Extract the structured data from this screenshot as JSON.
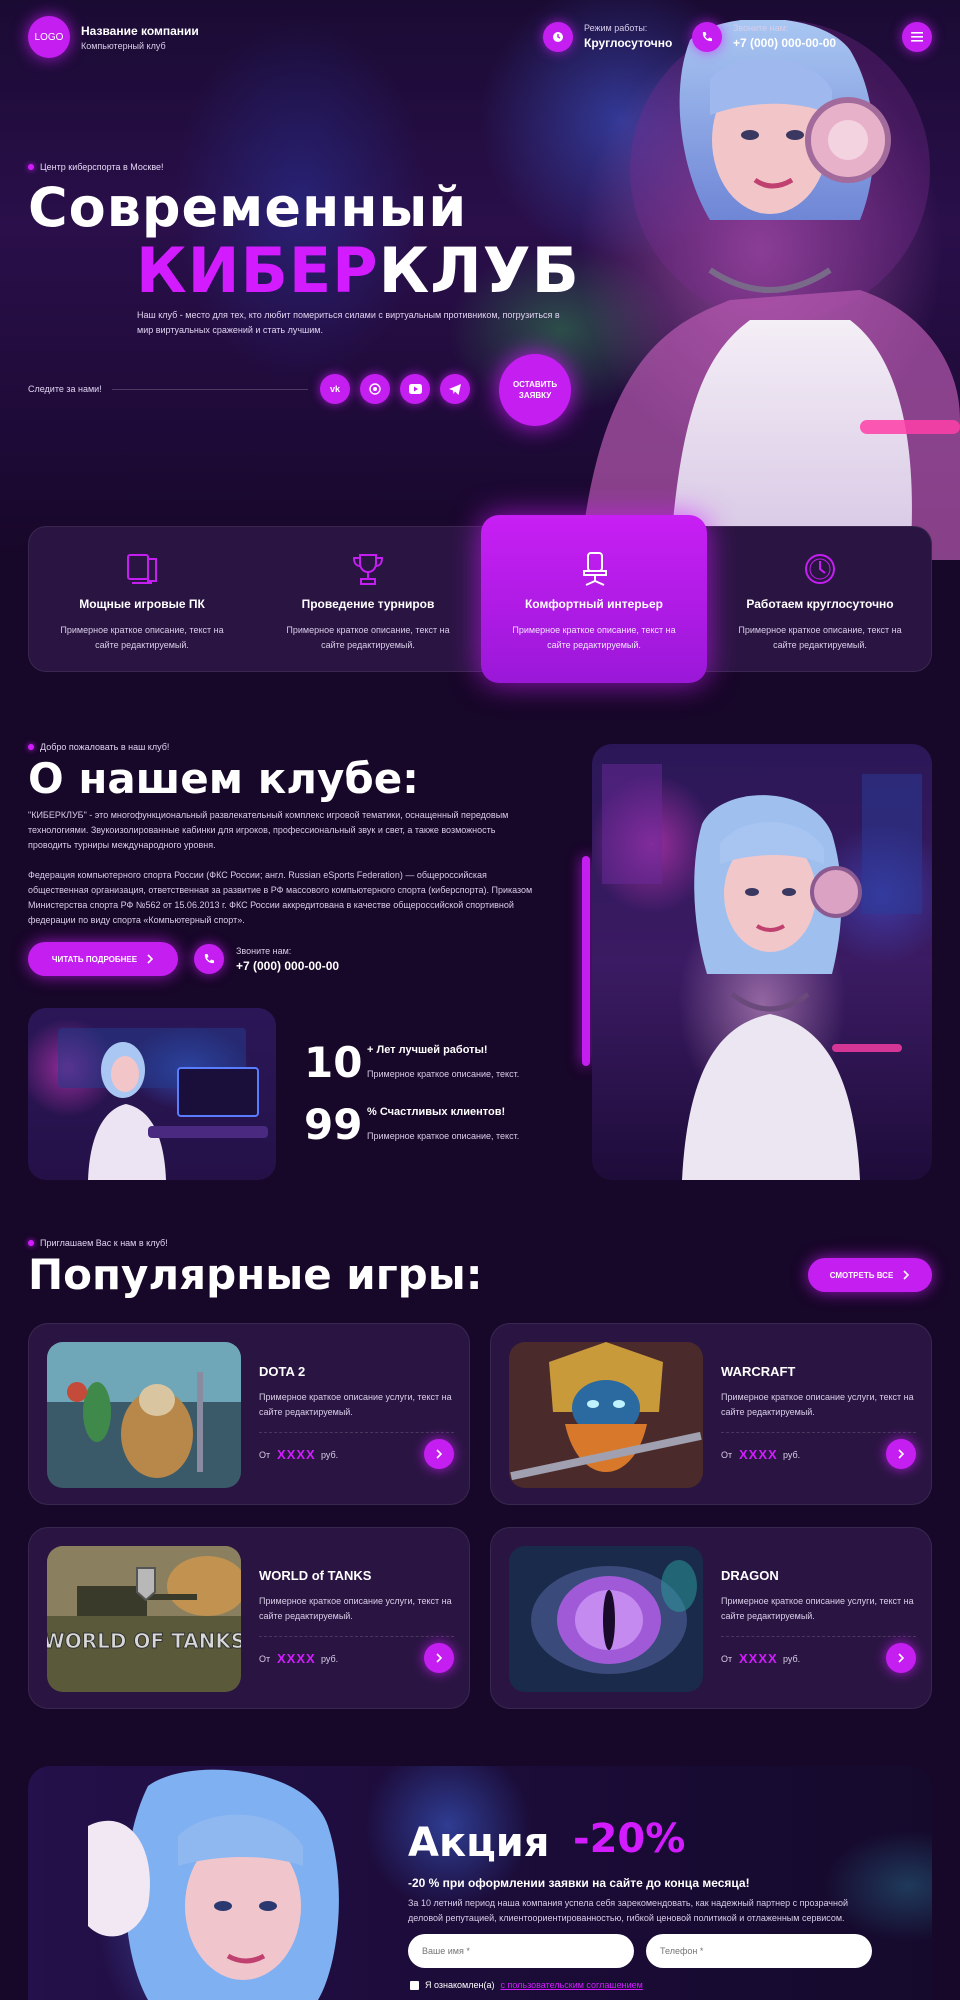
{
  "header": {
    "logo": "LOGO",
    "company_name": "Название компании",
    "company_sub": "Компьютерный клуб",
    "hours_label": "Режим работы:",
    "hours_value": "Круглосуточно",
    "phone_label": "Звоните нам:",
    "phone_value": "+7 (000) 000-00-00"
  },
  "hero": {
    "eyebrow": "Центр киберспорта в Москве!",
    "title_line1": "Современный",
    "title_accent": "КИБЕР",
    "title_rest": "КЛУБ",
    "description": "Наш клуб - место для тех, кто любит помериться силами с виртуальным противником, погрузиться в мир виртуальных сражений и стать лучшим.",
    "follow_label": "Следите за нами!",
    "socials": [
      "vk-icon",
      "whatsapp-icon",
      "youtube-icon",
      "telegram-icon"
    ],
    "cta": "ОСТАВИТЬ ЗАЯВКУ"
  },
  "features": [
    {
      "icon": "pc-icon",
      "title": "Мощные игровые ПК",
      "desc": "Примерное краткое описание, текст на сайте редактируемый."
    },
    {
      "icon": "trophy-icon",
      "title": "Проведение турниров",
      "desc": "Примерное краткое описание, текст на сайте редактируемый."
    },
    {
      "icon": "gaming-chair-icon",
      "title": "Комфортный интерьер",
      "desc": "Примерное краткое описание, текст на сайте редактируемый."
    },
    {
      "icon": "clock-icon",
      "title": "Работаем круглосуточно",
      "desc": "Примерное краткое описание, текст на сайте редактируемый."
    }
  ],
  "about": {
    "eyebrow": "Добро пожаловать в наш клуб!",
    "title": "О нашем клубе:",
    "p1": "\"КИБЕРКЛУБ\" - это многофункциональный развлекательный комплекс игровой тематики, оснащенный передовым технологиями. Звукоизолированные кабинки для игроков, профессиональный звук и свет, а также возможность проводить турниры международного уровня.",
    "p2": "Федерация компьютерного спорта России (ФКС России; англ. Russian eSports Federation) — общероссийская общественная организация, ответственная за развитие в РФ массового компьютерного спорта (киберспорта). Приказом Министерства спорта РФ №562 от 15.06.2013 г. ФКС России аккредитована в качестве общероссийской спортивной федерации по виду спорта «Компьютерный спорт».",
    "read_more": "ЧИТАТЬ ПОДРОБНЕЕ",
    "phone_label": "Звоните нам:",
    "phone_value": "+7 (000) 000-00-00",
    "stats": [
      {
        "num": "10",
        "label": "+ Лет лучшей работы!",
        "desc": "Примерное краткое описание, текст."
      },
      {
        "num": "99",
        "label": "% Счастливых клиентов!",
        "desc": "Примерное краткое описание, текст."
      }
    ]
  },
  "games": {
    "eyebrow": "Приглашаем Вас к нам в клуб!",
    "title": "Популярные игры:",
    "see_all": "СМОТРЕТЬ ВСЕ",
    "items": [
      {
        "title": "DOTA 2",
        "desc": "Примерное краткое описание услуги, текст на сайте редактируемый.",
        "from": "От",
        "price": "XXXX",
        "unit": "руб."
      },
      {
        "title": "WARCRAFT",
        "desc": "Примерное краткое описание услуги, текст на сайте редактируемый.",
        "from": "От",
        "price": "XXXX",
        "unit": "руб."
      },
      {
        "title": "WORLD of TANKS",
        "desc": "Примерное краткое описание услуги, текст на сайте редактируемый.",
        "from": "От",
        "price": "XXXX",
        "unit": "руб.",
        "logo_text": "WORLD OF TANKS"
      },
      {
        "title": "DRAGON",
        "desc": "Примерное краткое описание услуги, текст на сайте редактируемый.",
        "from": "От",
        "price": "XXXX",
        "unit": "руб."
      }
    ]
  },
  "promo": {
    "title": "Акция",
    "percent": "-20%",
    "subtitle": "-20 % при оформлении заявки на сайте до конца месяца!",
    "desc": "За 10 летний период наша компания успела себя зарекомендовать, как надежный партнер с прозрачной деловой репутацией, клиентоориентированностью, гибкой ценовой политикой и отлаженным сервисом.",
    "name_placeholder": "Ваше имя *",
    "phone_placeholder": "Телефон *",
    "consent_text": "Я ознакомлен(а)",
    "consent_link": "с пользовательским соглашением"
  }
}
